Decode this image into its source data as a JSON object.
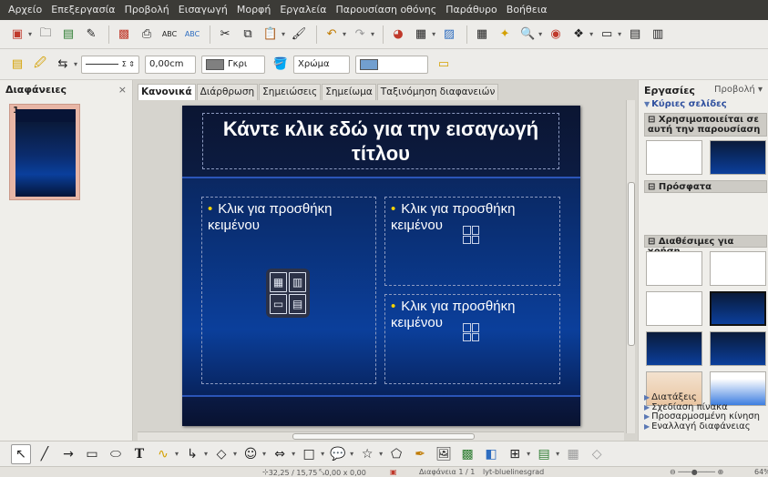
{
  "menu": [
    "Αρχείο",
    "Επεξεργασία",
    "Προβολή",
    "Εισαγωγή",
    "Μορφή",
    "Εργαλεία",
    "Παρουσίαση οθόνης",
    "Παράθυρο",
    "Βοήθεια"
  ],
  "toolbar2": {
    "line_width": "0,00cm",
    "line_color": "Γκρι",
    "area_style": "Χρώμα",
    "area_color": ""
  },
  "slides_pane": {
    "title": "Διαφάνειες",
    "close": "×",
    "slide_number": "1"
  },
  "tabs": [
    "Κανονικά",
    "Διάρθρωση",
    "Σημειώσεις",
    "Σημείωμα",
    "Ταξινόμηση διαφανειών"
  ],
  "slide": {
    "title": "Κάντε κλικ εδώ για την εισαγωγή τίτλου",
    "body_left": "Κλικ για προσθήκη κειμένου",
    "body_right_top": "Κλικ για προσθήκη κειμένου",
    "body_right_bottom": "Κλικ για προσθήκη κειμένου"
  },
  "task_pane": {
    "title": "Εργασίες",
    "view": "Προβολή",
    "master_pages": "Κύριες σελίδες",
    "used_in_presentation": "Χρησιμοποιείται σε αυτή την παρουσίαση",
    "recent": "Πρόσφατα",
    "available": "Διαθέσιμες για χρήση",
    "links": [
      "Διατάξεις",
      "Σχεδίαση πίνακα",
      "Προσαρμοσμένη κίνηση",
      "Εναλλαγή διαφάνειας"
    ]
  },
  "status": {
    "position": "32,25 / 15,75",
    "size": "0,00 x 0,00",
    "slide_info": "Διαφάνεια 1 / 1",
    "master": "lyt-bluelinesgrad",
    "zoom": "64%"
  }
}
